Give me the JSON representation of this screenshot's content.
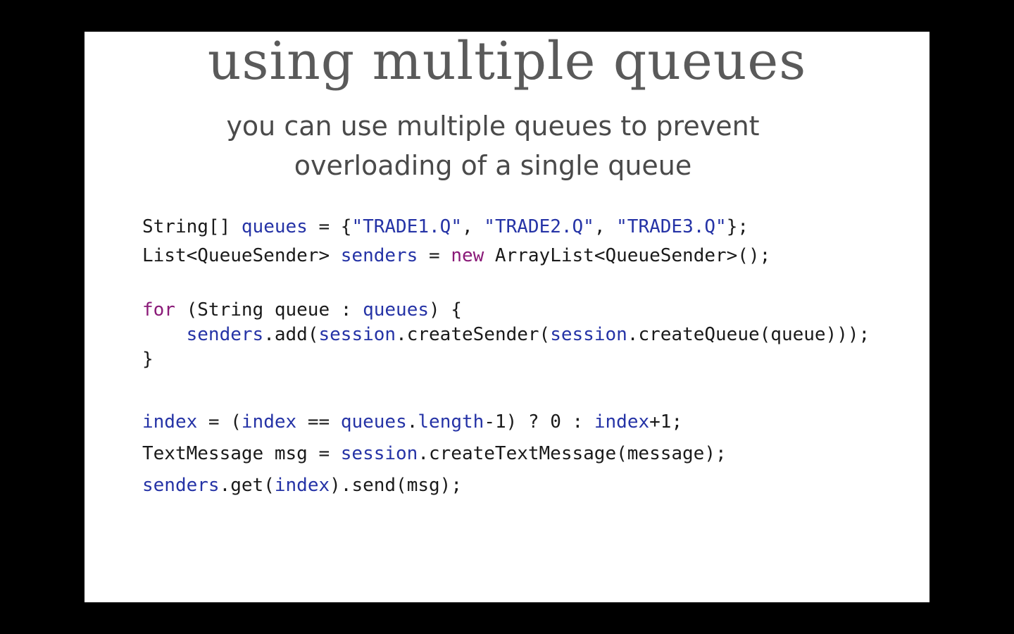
{
  "slide": {
    "title": "using multiple queues",
    "subtitle_line1": "you can use multiple queues to prevent",
    "subtitle_line2": "overloading of a single queue"
  },
  "colors": {
    "background": "#000000",
    "slide": "#ffffff",
    "title": "#5a5a5a",
    "keyword": "#8a1a78",
    "variable": "#2533a6",
    "plain": "#1a1a1a"
  },
  "code": {
    "lines": [
      [
        {
          "t": "String[] ",
          "c": "plain"
        },
        {
          "t": "queues",
          "c": "var"
        },
        {
          "t": " = {",
          "c": "plain"
        },
        {
          "t": "\"TRADE1.Q\"",
          "c": "str"
        },
        {
          "t": ", ",
          "c": "plain"
        },
        {
          "t": "\"TRADE2.Q\"",
          "c": "str"
        },
        {
          "t": ", ",
          "c": "plain"
        },
        {
          "t": "\"TRADE3.Q\"",
          "c": "str"
        },
        {
          "t": "};",
          "c": "plain"
        }
      ],
      [
        {
          "t": "List<QueueSender> ",
          "c": "plain"
        },
        {
          "t": "senders",
          "c": "var"
        },
        {
          "t": " = ",
          "c": "plain"
        },
        {
          "t": "new",
          "c": "kw"
        },
        {
          "t": " ArrayList<QueueSender>();",
          "c": "plain"
        }
      ],
      [
        {
          "t": "for",
          "c": "kw"
        },
        {
          "t": " (String queue : ",
          "c": "plain"
        },
        {
          "t": "queues",
          "c": "var"
        },
        {
          "t": ") {",
          "c": "plain"
        }
      ],
      [
        {
          "t": "    ",
          "c": "plain"
        },
        {
          "t": "senders",
          "c": "var"
        },
        {
          "t": ".add(",
          "c": "plain"
        },
        {
          "t": "session",
          "c": "var"
        },
        {
          "t": ".createSender(",
          "c": "plain"
        },
        {
          "t": "session",
          "c": "var"
        },
        {
          "t": ".createQueue(queue)));",
          "c": "plain"
        }
      ],
      [
        {
          "t": "}",
          "c": "plain"
        }
      ],
      [
        {
          "t": "index",
          "c": "var"
        },
        {
          "t": " = (",
          "c": "plain"
        },
        {
          "t": "index",
          "c": "var"
        },
        {
          "t": " == ",
          "c": "plain"
        },
        {
          "t": "queues",
          "c": "var"
        },
        {
          "t": ".",
          "c": "plain"
        },
        {
          "t": "length",
          "c": "var"
        },
        {
          "t": "-1) ? 0 : ",
          "c": "plain"
        },
        {
          "t": "index",
          "c": "var"
        },
        {
          "t": "+1;",
          "c": "plain"
        }
      ],
      [
        {
          "t": "TextMessage msg = ",
          "c": "plain"
        },
        {
          "t": "session",
          "c": "var"
        },
        {
          "t": ".createTextMessage(message);",
          "c": "plain"
        }
      ],
      [
        {
          "t": "senders",
          "c": "var"
        },
        {
          "t": ".get(",
          "c": "plain"
        },
        {
          "t": "index",
          "c": "var"
        },
        {
          "t": ").send(msg);",
          "c": "plain"
        }
      ]
    ]
  }
}
